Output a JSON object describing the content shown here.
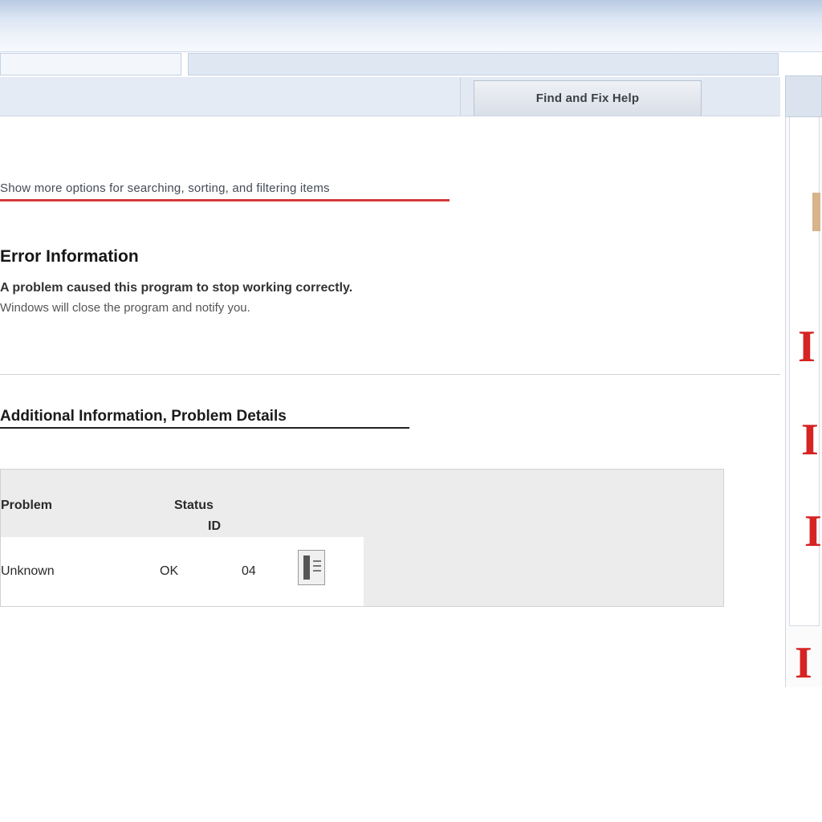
{
  "window": {
    "active_tab_label": "Find and Fix Help"
  },
  "content": {
    "info_link": "Show more options for searching, sorting, and filtering items",
    "section_heading": "Error Information",
    "section_desc_line1": "A problem caused this program to stop working correctly.",
    "section_desc_line2": "Windows will close the program and notify you."
  },
  "details": {
    "subheading": "Additional Information, Problem Details",
    "columns": [
      "Problem",
      "Status",
      "ID"
    ],
    "rows": [
      {
        "name": "Unknown",
        "status": "OK",
        "id": "04"
      }
    ]
  },
  "side_marks": [
    "I",
    "I",
    "I",
    "I"
  ],
  "colors": {
    "accent_red": "#d62323",
    "chrome_blue": "#b9cae3"
  }
}
